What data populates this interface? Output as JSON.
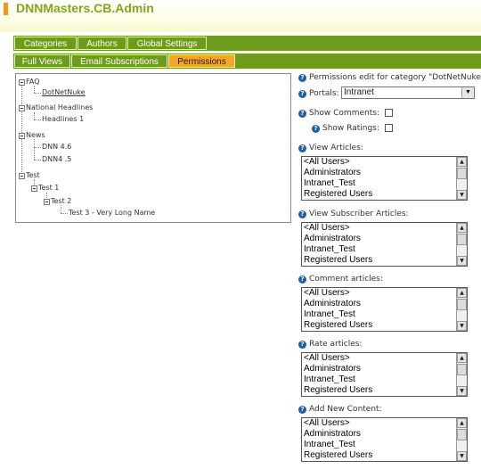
{
  "header": {
    "title": "DNNMasters.CB.Admin"
  },
  "tabs_row1": [
    "Categories",
    "Authors",
    "Global Settings"
  ],
  "tabs_row2": [
    "Full Views",
    "Email Subscriptions",
    "Permissions"
  ],
  "tree": {
    "faq": "FAQ",
    "dotnetnuke": "DotNetNuke",
    "national_headlines": "National Headlines",
    "headlines1": "Headlines 1",
    "news": "News",
    "dnn46": "DNN 4.6",
    "dnn45": "DNN4 .5",
    "test": "Test",
    "test1": "Test 1",
    "test2": "Test 2",
    "test3": "Test 3 - Very Long Name"
  },
  "permissions": {
    "heading": "Permissions edit for category \"DotNetNuke\"",
    "portals_label": "Portals:",
    "portals_value": "Intranet",
    "show_comments_label": "Show Comments:",
    "show_ratings_label": "Show Ratings:",
    "view_articles_label": "View Articles:",
    "view_subscriber_label": "View Subscriber Articles:",
    "comment_articles_label": "Comment articles:",
    "rate_articles_label": "Rate articles:",
    "add_new_content_label": "Add New Content:",
    "roles": [
      "<All Users>",
      "Administrators",
      "Intranet_Test",
      "Registered Users"
    ]
  }
}
